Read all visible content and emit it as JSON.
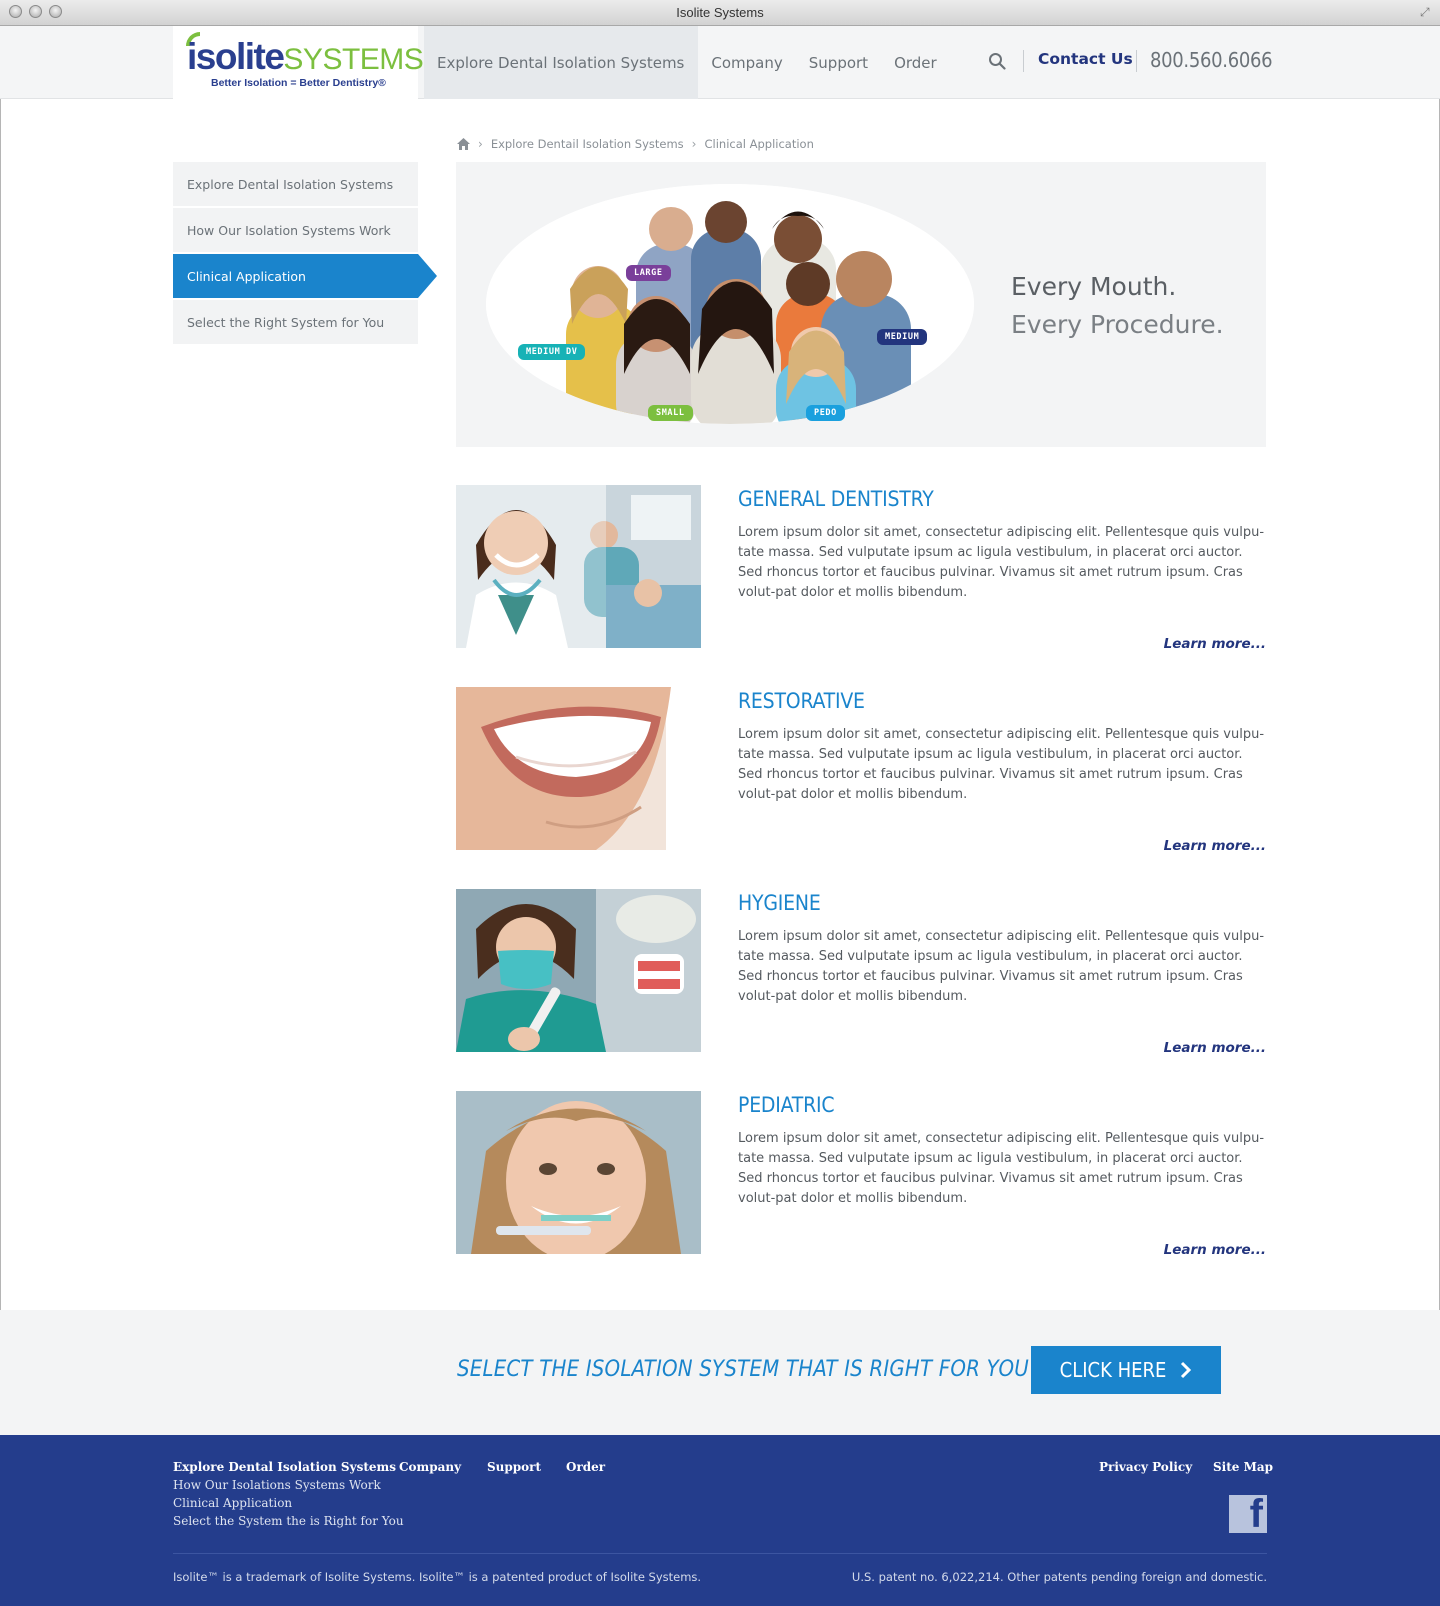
{
  "window": {
    "title": "Isolite Systems"
  },
  "header": {
    "logo": {
      "wordmark_left": "isolite",
      "wordmark_right": "SYSTEMS",
      "tagline": "Better Isolation = Better Dentistry®"
    },
    "nav": [
      "Explore Dental Isolation Systems",
      "Company",
      "Support",
      "Order"
    ],
    "contact_label": "Contact Us",
    "phone": "800.560.6066"
  },
  "breadcrumb": [
    "Explore Dentail Isolation Systems",
    "Clinical Application"
  ],
  "sidebar": {
    "items": [
      {
        "label": "Explore Dental Isolation Systems",
        "active": false
      },
      {
        "label": "How Our Isolation Systems Work",
        "active": false
      },
      {
        "label": "Clinical Application",
        "active": true
      },
      {
        "label": "Select the Right System for You",
        "active": false
      }
    ]
  },
  "hero": {
    "line1": "Every Mouth.",
    "line2": "Every Procedure.",
    "badges": {
      "large": "LARGE",
      "medium": "MEDIUM",
      "medium_dv": "MEDIUM DV",
      "small": "SMALL",
      "pedo": "PEDO"
    },
    "badge_colors": {
      "large": "#7a3f9a",
      "medium": "#23357e",
      "medium_dv": "#17b2b6",
      "small": "#7cbf3f",
      "pedo": "#1aa0de"
    }
  },
  "sections": [
    {
      "title": "GENERAL DENTISTRY",
      "body": "Lorem ipsum dolor sit amet, consectetur adipiscing elit. Pellentesque quis vulpu-tate massa. Sed vulputate ipsum ac ligula vestibulum, in placerat orci auctor. Sed rhoncus tortor et faucibus pulvinar. Vivamus sit amet rutrum ipsum. Cras volut-pat dolor et mollis bibendum.",
      "link": "Learn more..."
    },
    {
      "title": "RESTORATIVE",
      "body": "Lorem ipsum dolor sit amet, consectetur adipiscing elit. Pellentesque quis vulpu-tate massa. Sed vulputate ipsum ac ligula vestibulum, in placerat orci auctor. Sed rhoncus tortor et faucibus pulvinar. Vivamus sit amet rutrum ipsum. Cras volut-pat dolor et mollis bibendum.",
      "link": "Learn more..."
    },
    {
      "title": "HYGIENE",
      "body": "Lorem ipsum dolor sit amet, consectetur adipiscing elit. Pellentesque quis vulpu-tate massa. Sed vulputate ipsum ac ligula vestibulum, in placerat orci auctor. Sed rhoncus tortor et faucibus pulvinar. Vivamus sit amet rutrum ipsum. Cras volut-pat dolor et mollis bibendum.",
      "link": "Learn more..."
    },
    {
      "title": "PEDIATRIC",
      "body": "Lorem ipsum dolor sit amet, consectetur adipiscing elit. Pellentesque quis vulpu-tate massa. Sed vulputate ipsum ac ligula vestibulum, in placerat orci auctor. Sed rhoncus tortor et faucibus pulvinar. Vivamus sit amet rutrum ipsum. Cras volut-pat dolor et mollis bibendum.",
      "link": "Learn more..."
    }
  ],
  "cta": {
    "text": "SELECT THE ISOLATION SYSTEM THAT IS RIGHT FOR YOU",
    "button": "CLICK HERE"
  },
  "footer": {
    "explore_head": "Explore Dental Isolation Systems",
    "explore_links": [
      "How Our Isolations Systems Work",
      "Clinical Application",
      "Select the System the is Right for You"
    ],
    "company": "Company",
    "support": "Support",
    "order": "Order",
    "privacy": "Privacy Policy",
    "sitemap": "Site Map",
    "legal_left": "Isolite™ is a trademark of Isolite Systems. Isolite™ is a patented product of Isolite Systems.",
    "legal_right": "U.S. patent no. 6,022,214. Other patents pending foreign and domestic."
  },
  "colors": {
    "accent": "#1a84cc",
    "brand_navy": "#243d8c",
    "brand_green": "#7cbf3f"
  }
}
